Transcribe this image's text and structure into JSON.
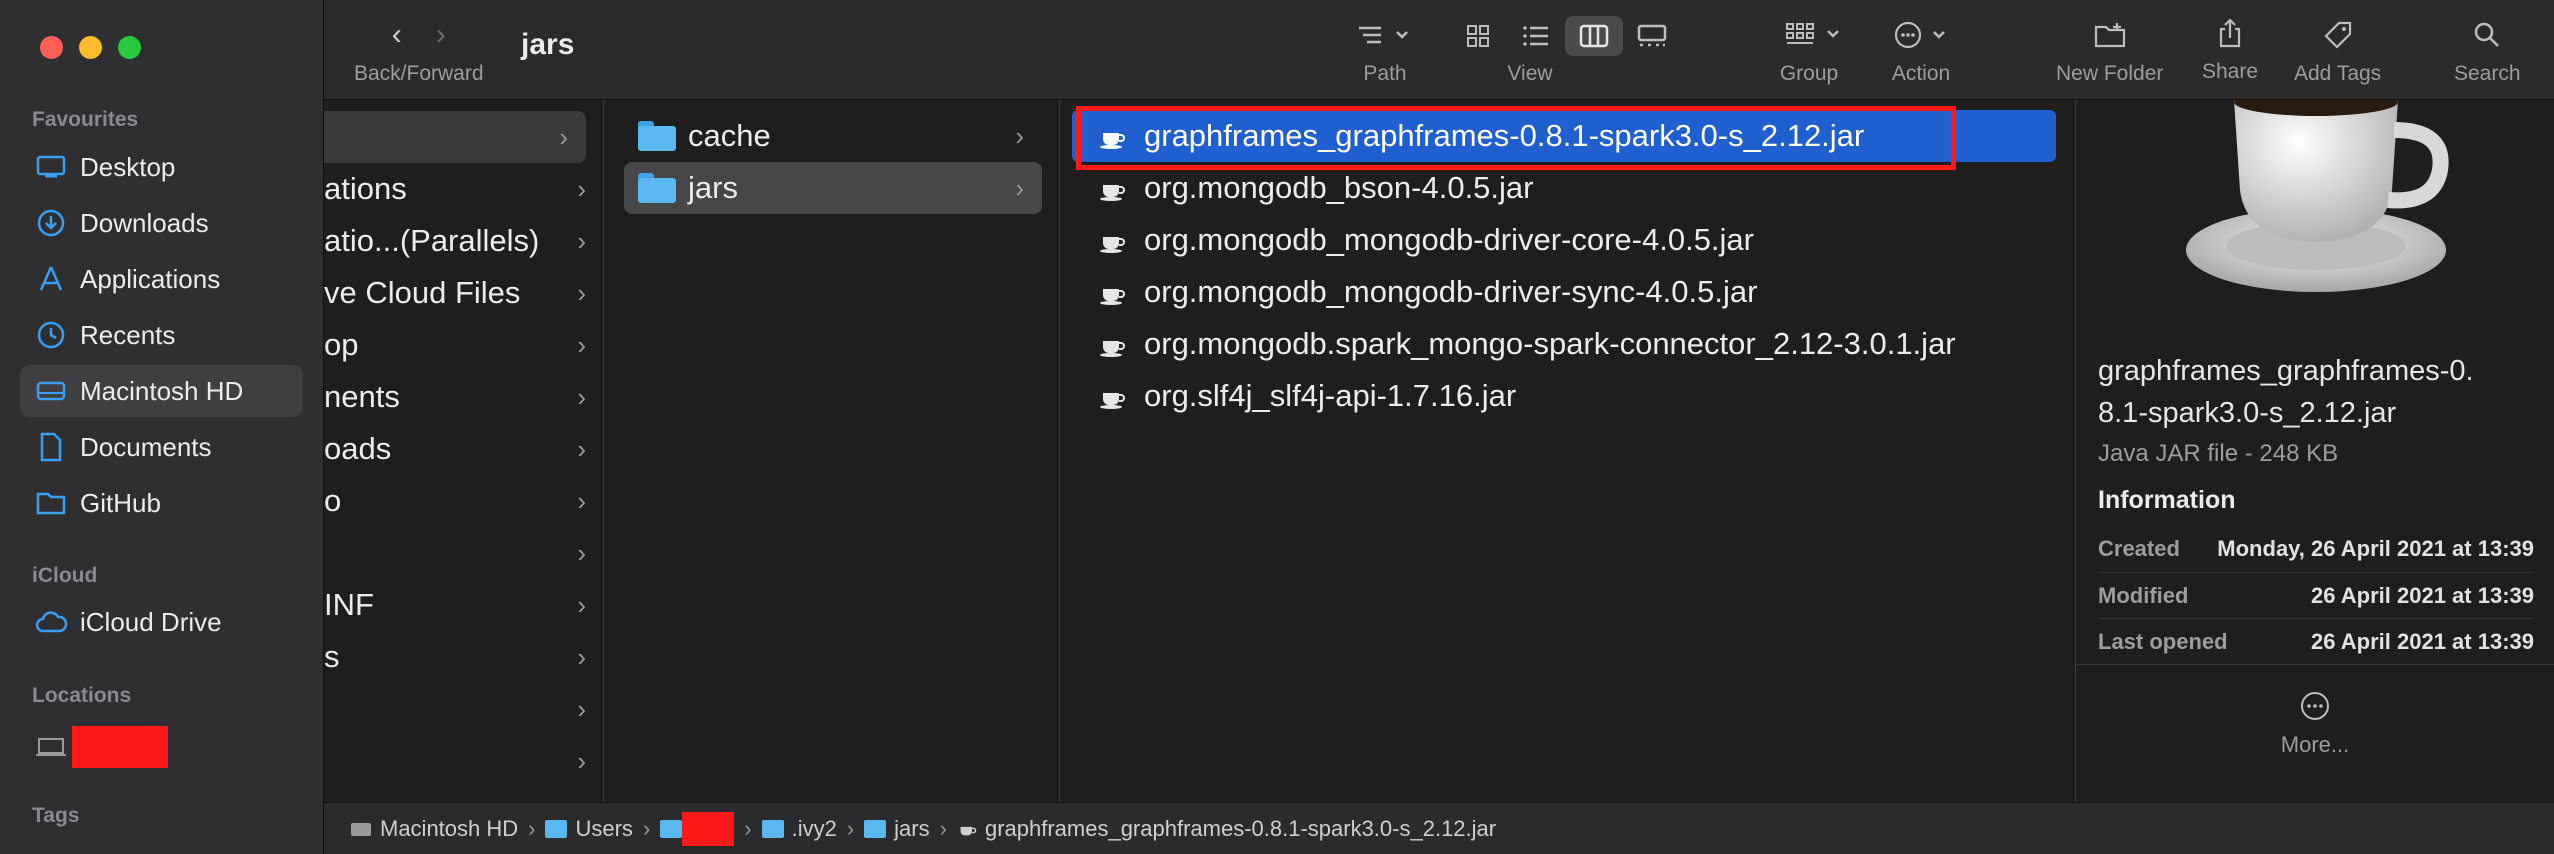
{
  "window": {
    "title": "jars"
  },
  "toolbar": {
    "back_forward_label": "Back/Forward",
    "path_label": "Path",
    "view_label": "View",
    "group_label": "Group",
    "action_label": "Action",
    "new_folder_label": "New Folder",
    "share_label": "Share",
    "add_tags_label": "Add Tags",
    "search_label": "Search",
    "active_view": "columns"
  },
  "sidebar": {
    "favourites_title": "Favourites",
    "favourites": [
      {
        "label": "Desktop",
        "icon": "desktop-icon"
      },
      {
        "label": "Downloads",
        "icon": "downloads-icon"
      },
      {
        "label": "Applications",
        "icon": "applications-icon"
      },
      {
        "label": "Recents",
        "icon": "recents-icon"
      },
      {
        "label": "Macintosh HD",
        "icon": "disk-icon",
        "selected": true
      },
      {
        "label": "Documents",
        "icon": "document-icon"
      },
      {
        "label": "GitHub",
        "icon": "folder-icon"
      }
    ],
    "icloud_title": "iCloud",
    "icloud": [
      {
        "label": "iCloud Drive",
        "icon": "cloud-icon"
      }
    ],
    "locations_title": "Locations",
    "tags_title": "Tags"
  },
  "column1": {
    "items": [
      "",
      "ations",
      "atio...(Parallels)",
      "ve Cloud Files",
      "op",
      "nents",
      "oads",
      "o",
      "",
      "INF",
      "s",
      "",
      ""
    ]
  },
  "column2": {
    "items": [
      {
        "label": "cache",
        "selected": false
      },
      {
        "label": "jars",
        "selected": true
      }
    ]
  },
  "column3": {
    "items": [
      {
        "label": "graphframes_graphframes-0.8.1-spark3.0-s_2.12.jar",
        "selected": true
      },
      {
        "label": "org.mongodb_bson-4.0.5.jar",
        "selected": false
      },
      {
        "label": "org.mongodb_mongodb-driver-core-4.0.5.jar",
        "selected": false
      },
      {
        "label": "org.mongodb_mongodb-driver-sync-4.0.5.jar",
        "selected": false
      },
      {
        "label": "org.mongodb.spark_mongo-spark-connector_2.12-3.0.1.jar",
        "selected": false
      },
      {
        "label": "org.slf4j_slf4j-api-1.7.16.jar",
        "selected": false
      }
    ]
  },
  "preview": {
    "file_name_line1": "graphframes_graphframes-0.",
    "file_name_line2": "8.1-spark3.0-s_2.12.jar",
    "kind": "Java JAR file - 248 KB",
    "information_title": "Information",
    "rows": [
      {
        "key": "Created",
        "value": "Monday, 26 April 2021 at 13:39"
      },
      {
        "key": "Modified",
        "value": "26 April 2021 at 13:39"
      },
      {
        "key": "Last opened",
        "value": "26 April 2021 at 13:39"
      }
    ],
    "more_label": "More..."
  },
  "pathbar": {
    "items": [
      "Macintosh HD",
      "Users",
      "",
      ".ivy2",
      "jars",
      "graphframes_graphframes-0.8.1-spark3.0-s_2.12.jar"
    ]
  },
  "colors": {
    "selection": "#1f5fcf",
    "highlight_box": "#ff1a1a",
    "folder": "#5ab7ef",
    "redaction": "#ff1a1a"
  }
}
